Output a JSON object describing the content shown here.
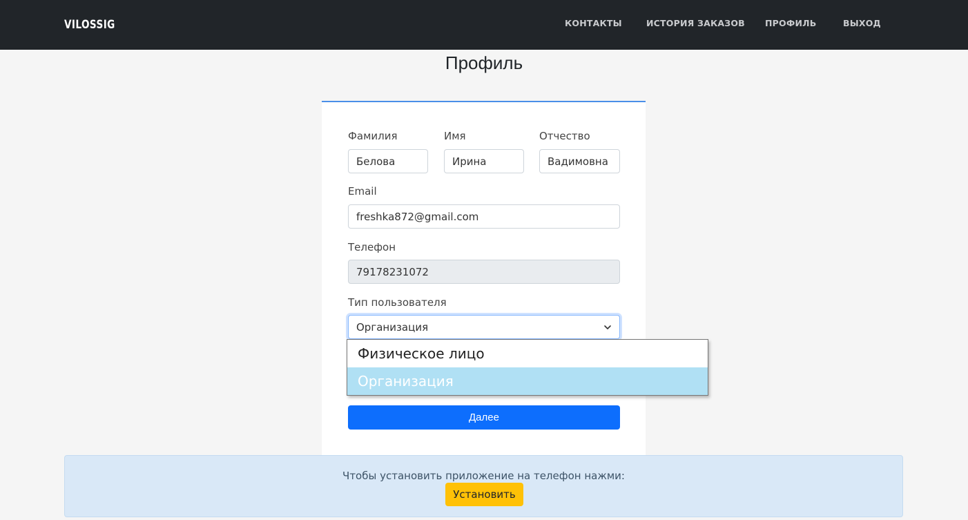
{
  "navbar": {
    "logo": "VILOSSIG",
    "links": [
      "КОНТАКТЫ",
      "ИСТОРИЯ ЗАКАЗОВ",
      "ПРОФИЛЬ",
      "ВЫХОД"
    ]
  },
  "page": {
    "title": "Профиль"
  },
  "form": {
    "last_name": {
      "label": "Фамилия",
      "value": "Белова"
    },
    "first_name": {
      "label": "Имя",
      "value": "Ирина"
    },
    "patronymic": {
      "label": "Отчество",
      "value": "Вадимовна"
    },
    "email": {
      "label": "Email",
      "value": "freshka872@gmail.com"
    },
    "phone": {
      "label": "Телефон",
      "value": "79178231072"
    },
    "user_type": {
      "label": "Тип пользователя",
      "value": "Организация",
      "options": [
        "Физическое лицо",
        "Организация"
      ],
      "selected_index": 1
    },
    "next_button": "Далее"
  },
  "banner": {
    "text": "Чтобы установить приложение на телефон нажми:",
    "install_button": "Установить"
  },
  "colors": {
    "navbar": "#212529",
    "primary": "#0d6efd",
    "install": "#ffc107",
    "banner_bg": "#d9e8f7",
    "selected_option": "#b0e0f4"
  }
}
